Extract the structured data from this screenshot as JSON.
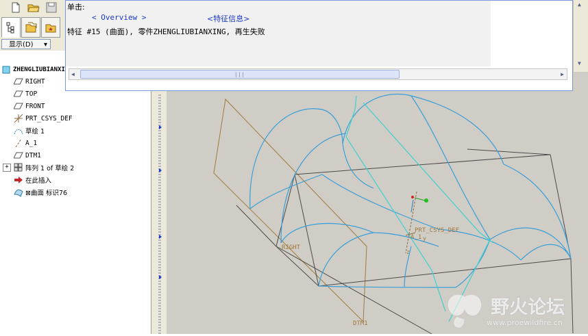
{
  "toolbar": {
    "icons": [
      "new-file-icon",
      "open-folder-icon",
      "save-icon"
    ]
  },
  "tabs": {
    "icons": [
      "model-tree-icon",
      "folder-browser-icon",
      "favorites-icon"
    ]
  },
  "show_button": {
    "label": "显示(D)"
  },
  "tree": {
    "root": "ZHENGLIUBIANXI",
    "items": [
      {
        "label": "RIGHT",
        "icon": "datum-plane-icon"
      },
      {
        "label": "TOP",
        "icon": "datum-plane-icon"
      },
      {
        "label": "FRONT",
        "icon": "datum-plane-icon"
      },
      {
        "label": "PRT_CSYS_DEF",
        "icon": "csys-icon"
      },
      {
        "label": "草绘 1",
        "icon": "sketch-icon"
      },
      {
        "label": "A_1",
        "icon": "datum-axis-icon"
      },
      {
        "label": "DTM1",
        "icon": "datum-plane-icon"
      },
      {
        "label": "阵列 1 of 草绘 2",
        "icon": "pattern-icon"
      },
      {
        "label": "在此插入",
        "icon": "insert-here-arrow-icon"
      },
      {
        "label": "⊠曲面 标识76",
        "icon": "surface-icon"
      }
    ]
  },
  "message": {
    "click_label": "单击:",
    "link_overview": "< Overview >",
    "link_feature_info": "<特征信息>",
    "line": "特征 #15 (曲面), 零件ZHENGLIUBIANXING, 再生失败"
  },
  "graphics": {
    "datum_labels": {
      "right": "RIGHT",
      "dtm1": "DTM1",
      "csys": "PRT_CSYS_DEF",
      "axis": "A_1",
      "axis_y": "y",
      "axis_z": "z"
    }
  },
  "watermark": {
    "brand": "野火论坛",
    "url": "www.proewildfire.cn"
  },
  "colors": {
    "curve_blue": "#3a9ed8",
    "datum_brown": "#a07a3c",
    "edge_dark": "#4a4a4a",
    "axis_cyan": "#3fd0d0",
    "link_blue": "#1a39c8"
  }
}
